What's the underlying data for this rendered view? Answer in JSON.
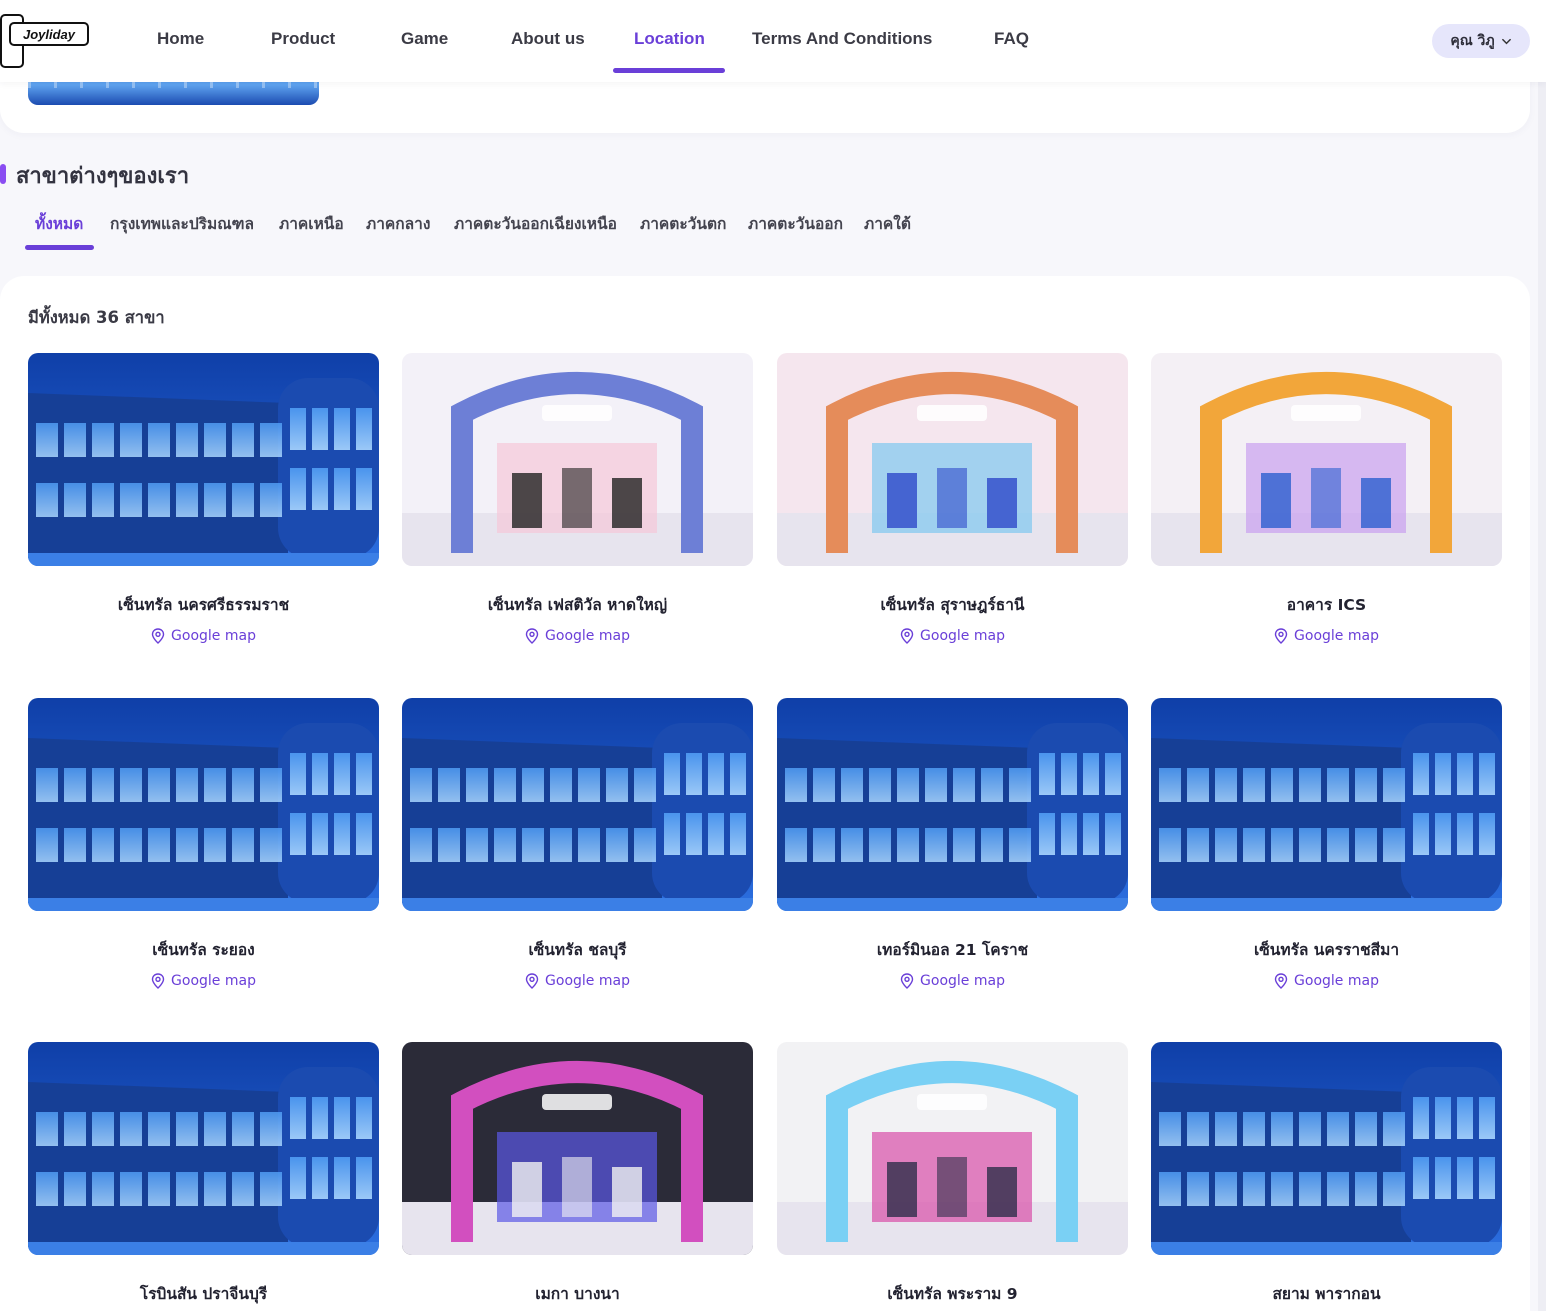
{
  "header": {
    "logo_text": "Joyliday",
    "nav": [
      {
        "label": "Home",
        "active": false
      },
      {
        "label": "Product",
        "active": false
      },
      {
        "label": "Game",
        "active": false
      },
      {
        "label": "About us",
        "active": false
      },
      {
        "label": "Location",
        "active": true
      },
      {
        "label": "Terms And Conditions",
        "active": false
      },
      {
        "label": "FAQ",
        "active": false
      }
    ],
    "user_label": "คุณ วิภู",
    "accent": "#6a3fd8"
  },
  "section": {
    "title": "สาขาต่างๆของเรา",
    "tabs": [
      {
        "label": "ทั้งหมด",
        "active": true
      },
      {
        "label": "กรุงเทพและปริมณฑล",
        "active": false
      },
      {
        "label": "ภาคเหนือ",
        "active": false
      },
      {
        "label": "ภาคกลาง",
        "active": false
      },
      {
        "label": "ภาคตะวันออกเฉียงเหนือ",
        "active": false
      },
      {
        "label": "ภาคตะวันตก",
        "active": false
      },
      {
        "label": "ภาคตะวันออก",
        "active": false
      },
      {
        "label": "ภาคใต้",
        "active": false
      }
    ]
  },
  "branches": {
    "count_label": "มีทั้งหมด 36 สาขา",
    "map_label": "Google map",
    "items": [
      {
        "name": "เซ็นทรัล นครศรีธรรมราช",
        "photo": "building"
      },
      {
        "name": "เซ็นทรัล เฟสติวัล หาดใหญ่",
        "photo": "store-stripes"
      },
      {
        "name": "เซ็นทรัล สุราษฎร์ธานี",
        "photo": "store-arches"
      },
      {
        "name": "อาคาร ICS",
        "photo": "store-colorful"
      },
      {
        "name": "เซ็นทรัล ระยอง",
        "photo": "building"
      },
      {
        "name": "เซ็นทรัล ชลบุรี",
        "photo": "building"
      },
      {
        "name": "เทอร์มินอล 21 โคราช",
        "photo": "building"
      },
      {
        "name": "เซ็นทรัล นครราชสีมา",
        "photo": "building"
      },
      {
        "name": "โรบินสัน ปราจีนบุรี",
        "photo": "building"
      },
      {
        "name": "เมกา บางนา",
        "photo": "store-purple"
      },
      {
        "name": "เซ็นทรัล พระราม 9",
        "photo": "store-tunnel"
      },
      {
        "name": "สยาม พารากอน",
        "photo": "building"
      }
    ]
  }
}
